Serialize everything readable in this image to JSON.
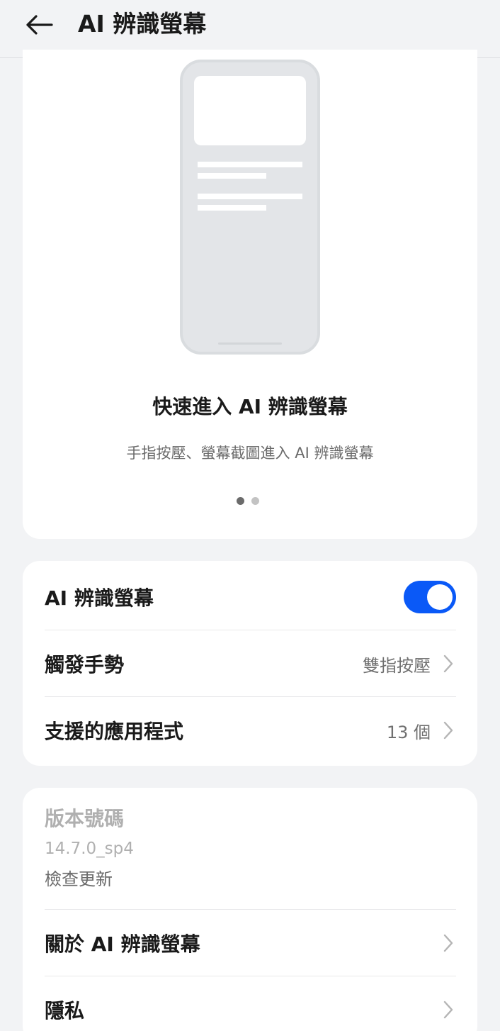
{
  "appbar": {
    "title": "AI 辨識螢幕",
    "back_icon": "arrow-left-icon"
  },
  "hero": {
    "title": "快速進入 AI 辨識螢幕",
    "subtitle": "手指按壓、螢幕截圖進入 AI 辨識螢幕",
    "pager": {
      "current": 1,
      "total": 2
    }
  },
  "settings": {
    "toggle_row": {
      "label": "AI 辨識螢幕",
      "enabled": true,
      "accent": "#0a59f7"
    },
    "gesture_row": {
      "label": "觸發手勢",
      "value": "雙指按壓"
    },
    "apps_row": {
      "label": "支援的應用程式",
      "value": "13 個"
    }
  },
  "about": {
    "version_label": "版本號碼",
    "version_number": "14.7.0_sp4",
    "check_update": "檢查更新",
    "about_row": {
      "label": "關於 AI 辨識螢幕"
    },
    "privacy_row": {
      "label": "隱私"
    }
  }
}
